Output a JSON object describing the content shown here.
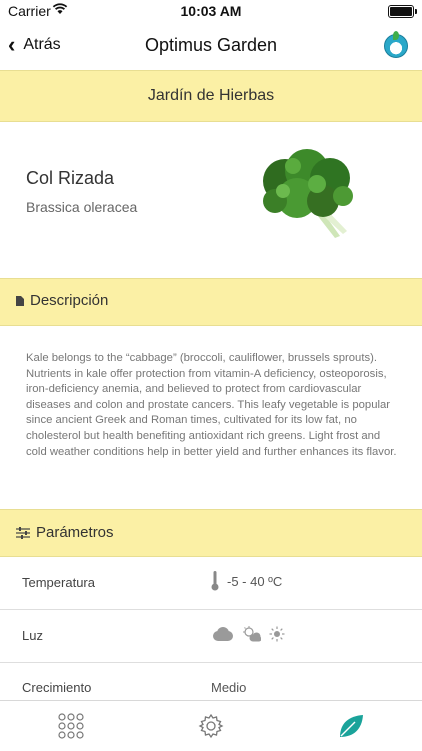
{
  "status": {
    "carrier": "Carrier",
    "time": "10:03 AM"
  },
  "nav": {
    "back_label": "Atrás",
    "title": "Optimus Garden"
  },
  "section_title": "Jardín de Hierbas",
  "plant": {
    "common_name": "Col Rizada",
    "scientific_name": "Brassica oleracea"
  },
  "description": {
    "heading": "Descripción",
    "text": "Kale belongs to the “cabbage” (broccoli, cauliflower, brussels sprouts). Nutrients in kale offer protection from vitamin-A deficiency, osteoporosis, iron-deficiency anemia, and believed to protect from cardiovascular diseases and colon and prostate cancers. This leafy vegetable is popular since ancient Greek and Roman times, cultivated for its low fat, no cholesterol but health benefiting antioxidant rich greens. Light frost and cold weather conditions help in better yield and further enhances its flavor."
  },
  "parameters": {
    "heading": "Parámetros",
    "rows": [
      {
        "label": "Temperatura",
        "value": "-5 - 40 ºC"
      },
      {
        "label": "Luz",
        "value": ""
      },
      {
        "label": "Crecimiento",
        "value": "Medio"
      }
    ]
  },
  "colors": {
    "band": "#fbf0a5",
    "accent": "#1aa39a"
  },
  "tabs": [
    "grid-icon",
    "settings-gear-icon",
    "leaf-icon"
  ]
}
